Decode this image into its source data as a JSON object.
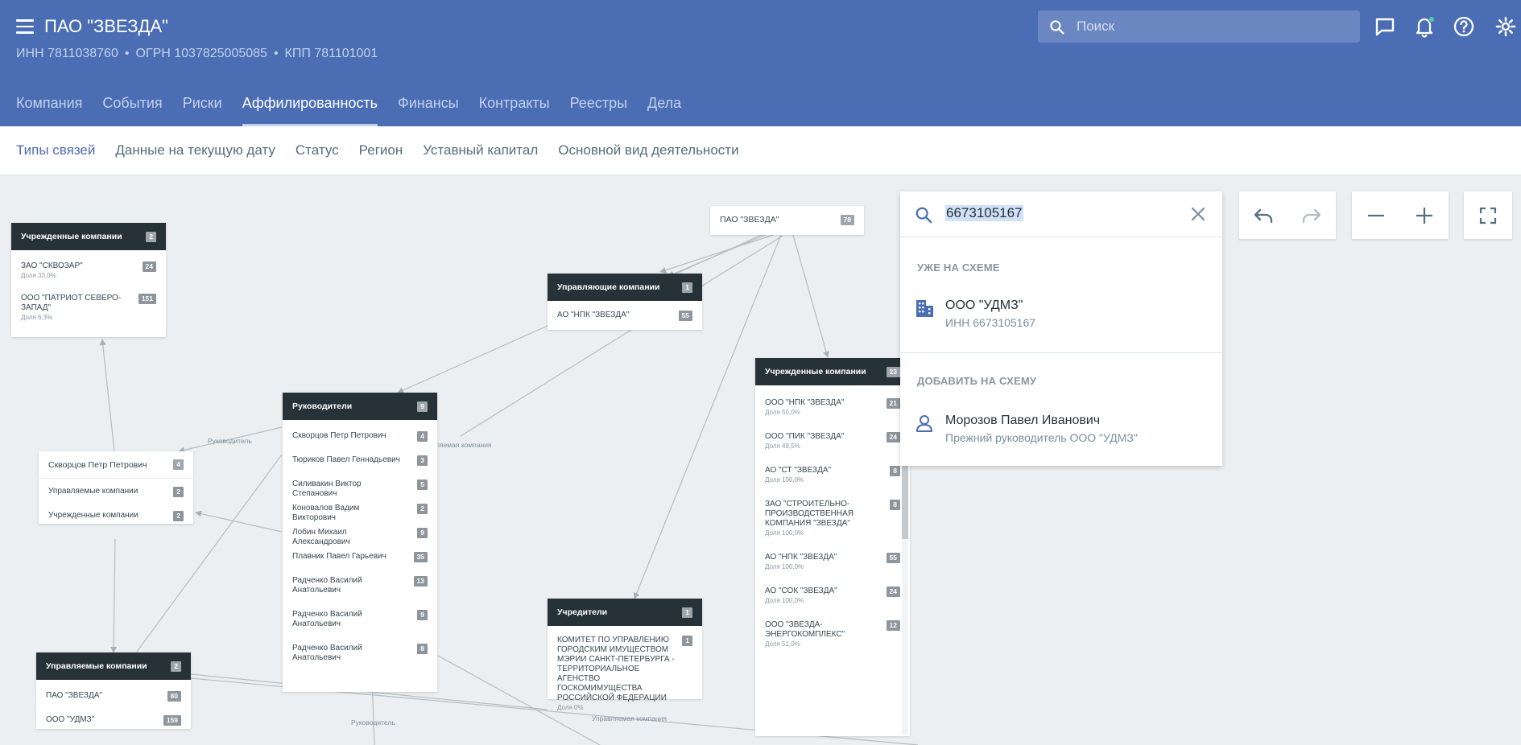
{
  "header": {
    "title": "ПАО \"ЗВЕЗДА\"",
    "inn": "ИНН 7811038760",
    "ogrn": "ОГРН 1037825005085",
    "kpp": "КПП 781101001",
    "search_placeholder": "Поиск"
  },
  "main_tabs": [
    "Компания",
    "События",
    "Риски",
    "Аффилированность",
    "Финансы",
    "Контракты",
    "Реестры",
    "Дела"
  ],
  "active_main_tab": "Аффилированность",
  "sub_tabs": [
    "Типы связей",
    "Данные на текущую дату",
    "Статус",
    "Регион",
    "Уставный капитал",
    "Основной вид деятельности"
  ],
  "active_sub_tab": "Типы связей",
  "colors": {
    "header": "#4a6db4",
    "node_header": "#263238",
    "accent": "#4a6db4"
  },
  "nodes": {
    "uchrezh_left": {
      "title": "Учрежденные компании",
      "count": "2",
      "rows": [
        {
          "name": "ЗАО \"СКВОЗАР\"",
          "share": "Доля 33,0%",
          "count": "24"
        },
        {
          "name": "ООО \"ПАТРИОТ СЕВЕРО-ЗАПАД\"",
          "share": "Доля 6,3%",
          "count": "151"
        }
      ]
    },
    "root": {
      "title": "ПАО \"ЗВЕЗДА\"",
      "count": "78"
    },
    "upravl_comp": {
      "title": "Управляющие компании",
      "count": "1",
      "rows": [
        {
          "name": "АО \"НПК \"ЗВЕЗДА\"",
          "count": "55"
        }
      ]
    },
    "skvortsov": {
      "title": "Скворцов Петр Петрович",
      "count": "4",
      "rows": [
        {
          "name": "Управляемые компании",
          "count": "2"
        },
        {
          "name": "Учрежденные компании",
          "count": "2"
        }
      ]
    },
    "rukovoditeli": {
      "title": "Руководители",
      "count": "9",
      "rows": [
        {
          "name": "Скворцов Петр Петрович",
          "count": "4"
        },
        {
          "name": "Тюриков Павел Геннадьевич",
          "count": "3"
        },
        {
          "name": "Силивакин Виктор Степанович",
          "count": "5"
        },
        {
          "name": "Коновалов Вадим Викторович",
          "count": "2"
        },
        {
          "name": "Лобин Михаил Александрович",
          "count": "9"
        },
        {
          "name": "Плавник Павел Гарьевич",
          "count": "35"
        },
        {
          "name": "Радченко Василий Анатольевич",
          "count": "13"
        },
        {
          "name": "Радченко Василий Анатольевич",
          "count": "9"
        },
        {
          "name": "Радченко Василий Анатольевич",
          "count": "8"
        }
      ]
    },
    "upravlyaemye": {
      "title": "Управляемые компании",
      "count": "2",
      "rows": [
        {
          "name": "ПАО \"ЗВЕЗДА\"",
          "count": "80"
        },
        {
          "name": "ООО \"УДМЗ\"",
          "count": "159"
        }
      ]
    },
    "uchrediteli": {
      "title": "Учредители",
      "count": "1",
      "rows": [
        {
          "name": "КОМИТЕТ ПО УПРАВЛЕНИЮ ГОРОДСКИМ ИМУЩЕСТВОМ МЭРИИ САНКТ-ПЕТЕРБУРГА - ТЕРРИТОРИАЛЬНОЕ АГЕНСТВО ГОСКОМИМУЩЕСТВА РОССИЙСКОЙ ФЕДЕРАЦИИ",
          "share": "Доля 0%",
          "count": "1"
        }
      ]
    },
    "uchrezh_right": {
      "title": "Учрежденные компании",
      "count": "23",
      "rows": [
        {
          "name": "ООО \"НПК \"ЗВЕЗДА\"",
          "share": "Доля 50,0%",
          "count": "21"
        },
        {
          "name": "ООО \"ПИК \"ЗВЕЗДА\"",
          "share": "Доля 49,5%",
          "count": "24"
        },
        {
          "name": "АО \"СТ \"ЗВЕЗДА\"",
          "share": "Доля 100,0%",
          "count": "8"
        },
        {
          "name": "ЗАО \"СТРОИТЕЛЬНО-ПРОИЗВОДСТВЕННАЯ КОМПАНИЯ \"ЗВЕЗДА\"",
          "share": "Доля 100,0%",
          "count": "8"
        },
        {
          "name": "АО \"НПК \"ЗВЕЗДА\"",
          "share": "Доля 100,0%",
          "count": "55"
        },
        {
          "name": "АО \"СОК \"ЗВЕЗДА\"",
          "share": "Доля 100,0%",
          "count": "24"
        },
        {
          "name": "ООО \"ЗВЕЗДА-ЭНЕРГОКОМПЛЕКС\"",
          "share": "Доля 51,0%",
          "count": "12"
        }
      ]
    }
  },
  "edge_labels": {
    "rukovoditel_1": "Руководитель",
    "upravl_partial": "ляемая компания",
    "rukovoditel_2": "Руководитель",
    "upravl_bottom": "Управляемая компания"
  },
  "search_panel": {
    "query": "6673105167",
    "section_on_scheme": "УЖЕ НА СХЕМЕ",
    "on_scheme_item": {
      "name": "ООО \"УДМЗ\"",
      "desc": "ИНН 6673105167",
      "icon": "building-icon"
    },
    "section_add": "ДОБАВИТЬ НА СХЕМУ",
    "add_item": {
      "name": "Морозов Павел Иванович",
      "desc": "Прежний руководитель ООО \"УДМЗ\"",
      "icon": "person-icon"
    }
  },
  "toolbar": [
    "undo-icon",
    "redo-icon",
    "zoom-out-icon",
    "zoom-in-icon",
    "fullscreen-icon"
  ]
}
